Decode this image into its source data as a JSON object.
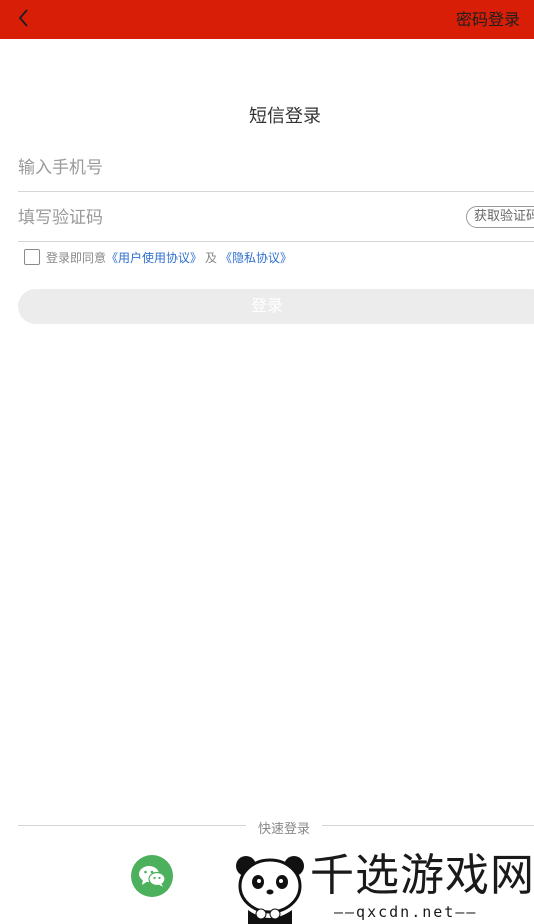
{
  "header": {
    "back_icon": "chevron-left-icon",
    "password_login_label": "密码登录",
    "bar_color": "#d81e06"
  },
  "page": {
    "title": "短信登录"
  },
  "form": {
    "phone_placeholder": "输入手机号",
    "phone_value": "",
    "code_placeholder": "填写验证码",
    "code_value": "",
    "get_code_label": "获取验证码"
  },
  "agreement": {
    "checked": false,
    "prefix": "登录即同意",
    "user_agreement": "《用户使用协议》",
    "and": "及",
    "privacy_policy": "《隐私协议》",
    "link_color": "#2f6fcf"
  },
  "login_button": {
    "label": "登录",
    "enabled": false
  },
  "quick_login": {
    "label": "快速登录",
    "wechat_icon": "wechat-icon",
    "wechat_color": "#4cb05c"
  },
  "watermark": {
    "title": "千选游戏网",
    "url": "——qxcdn.net——"
  }
}
